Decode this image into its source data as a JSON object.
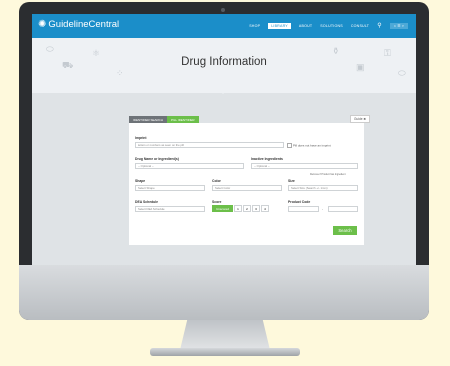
{
  "header": {
    "logo_text": "GuidelineCentral",
    "logo_icon": "gear-icon",
    "nav": [
      "SHOP",
      "LIBRARY",
      "ABOUT",
      "SOLUTIONS",
      "CONSULT"
    ],
    "active_nav": "LIBRARY",
    "account_label": "⌂ ☰ ▿"
  },
  "hero": {
    "title": "Drug Information"
  },
  "tabs": [
    "IDENTIFIER SEARCH",
    "PILL IDENTIFIER"
  ],
  "guide_label": "Guide ✖",
  "form": {
    "imprint_label": "Imprint",
    "imprint_placeholder": "letters or numbers as seen on the pill",
    "no_imprint_label": "Pill does not have an imprint",
    "drug_label": "Drug Name or Ingredient(s)",
    "drug_value": "-- Optional --",
    "inactive_label": "Inactive Ingredients",
    "inactive_value": "-- Optional --",
    "remove_hint": "Remove if Product has Ingredient",
    "shape_label": "Shape",
    "shape_value": "Select Shape",
    "color_label": "Color",
    "color_value": "Select Color",
    "size_label": "Size",
    "size_value": "Select Size (Search +/- 1mm)",
    "dea_label": "DEA Schedule",
    "dea_value": "Select DEA Schedule",
    "score_label": "Score",
    "score_options": [
      "Unscored",
      "1",
      "2",
      "3",
      "4"
    ],
    "product_code_label": "Product Code",
    "product_code_sep": "-",
    "search_label": "Search"
  }
}
